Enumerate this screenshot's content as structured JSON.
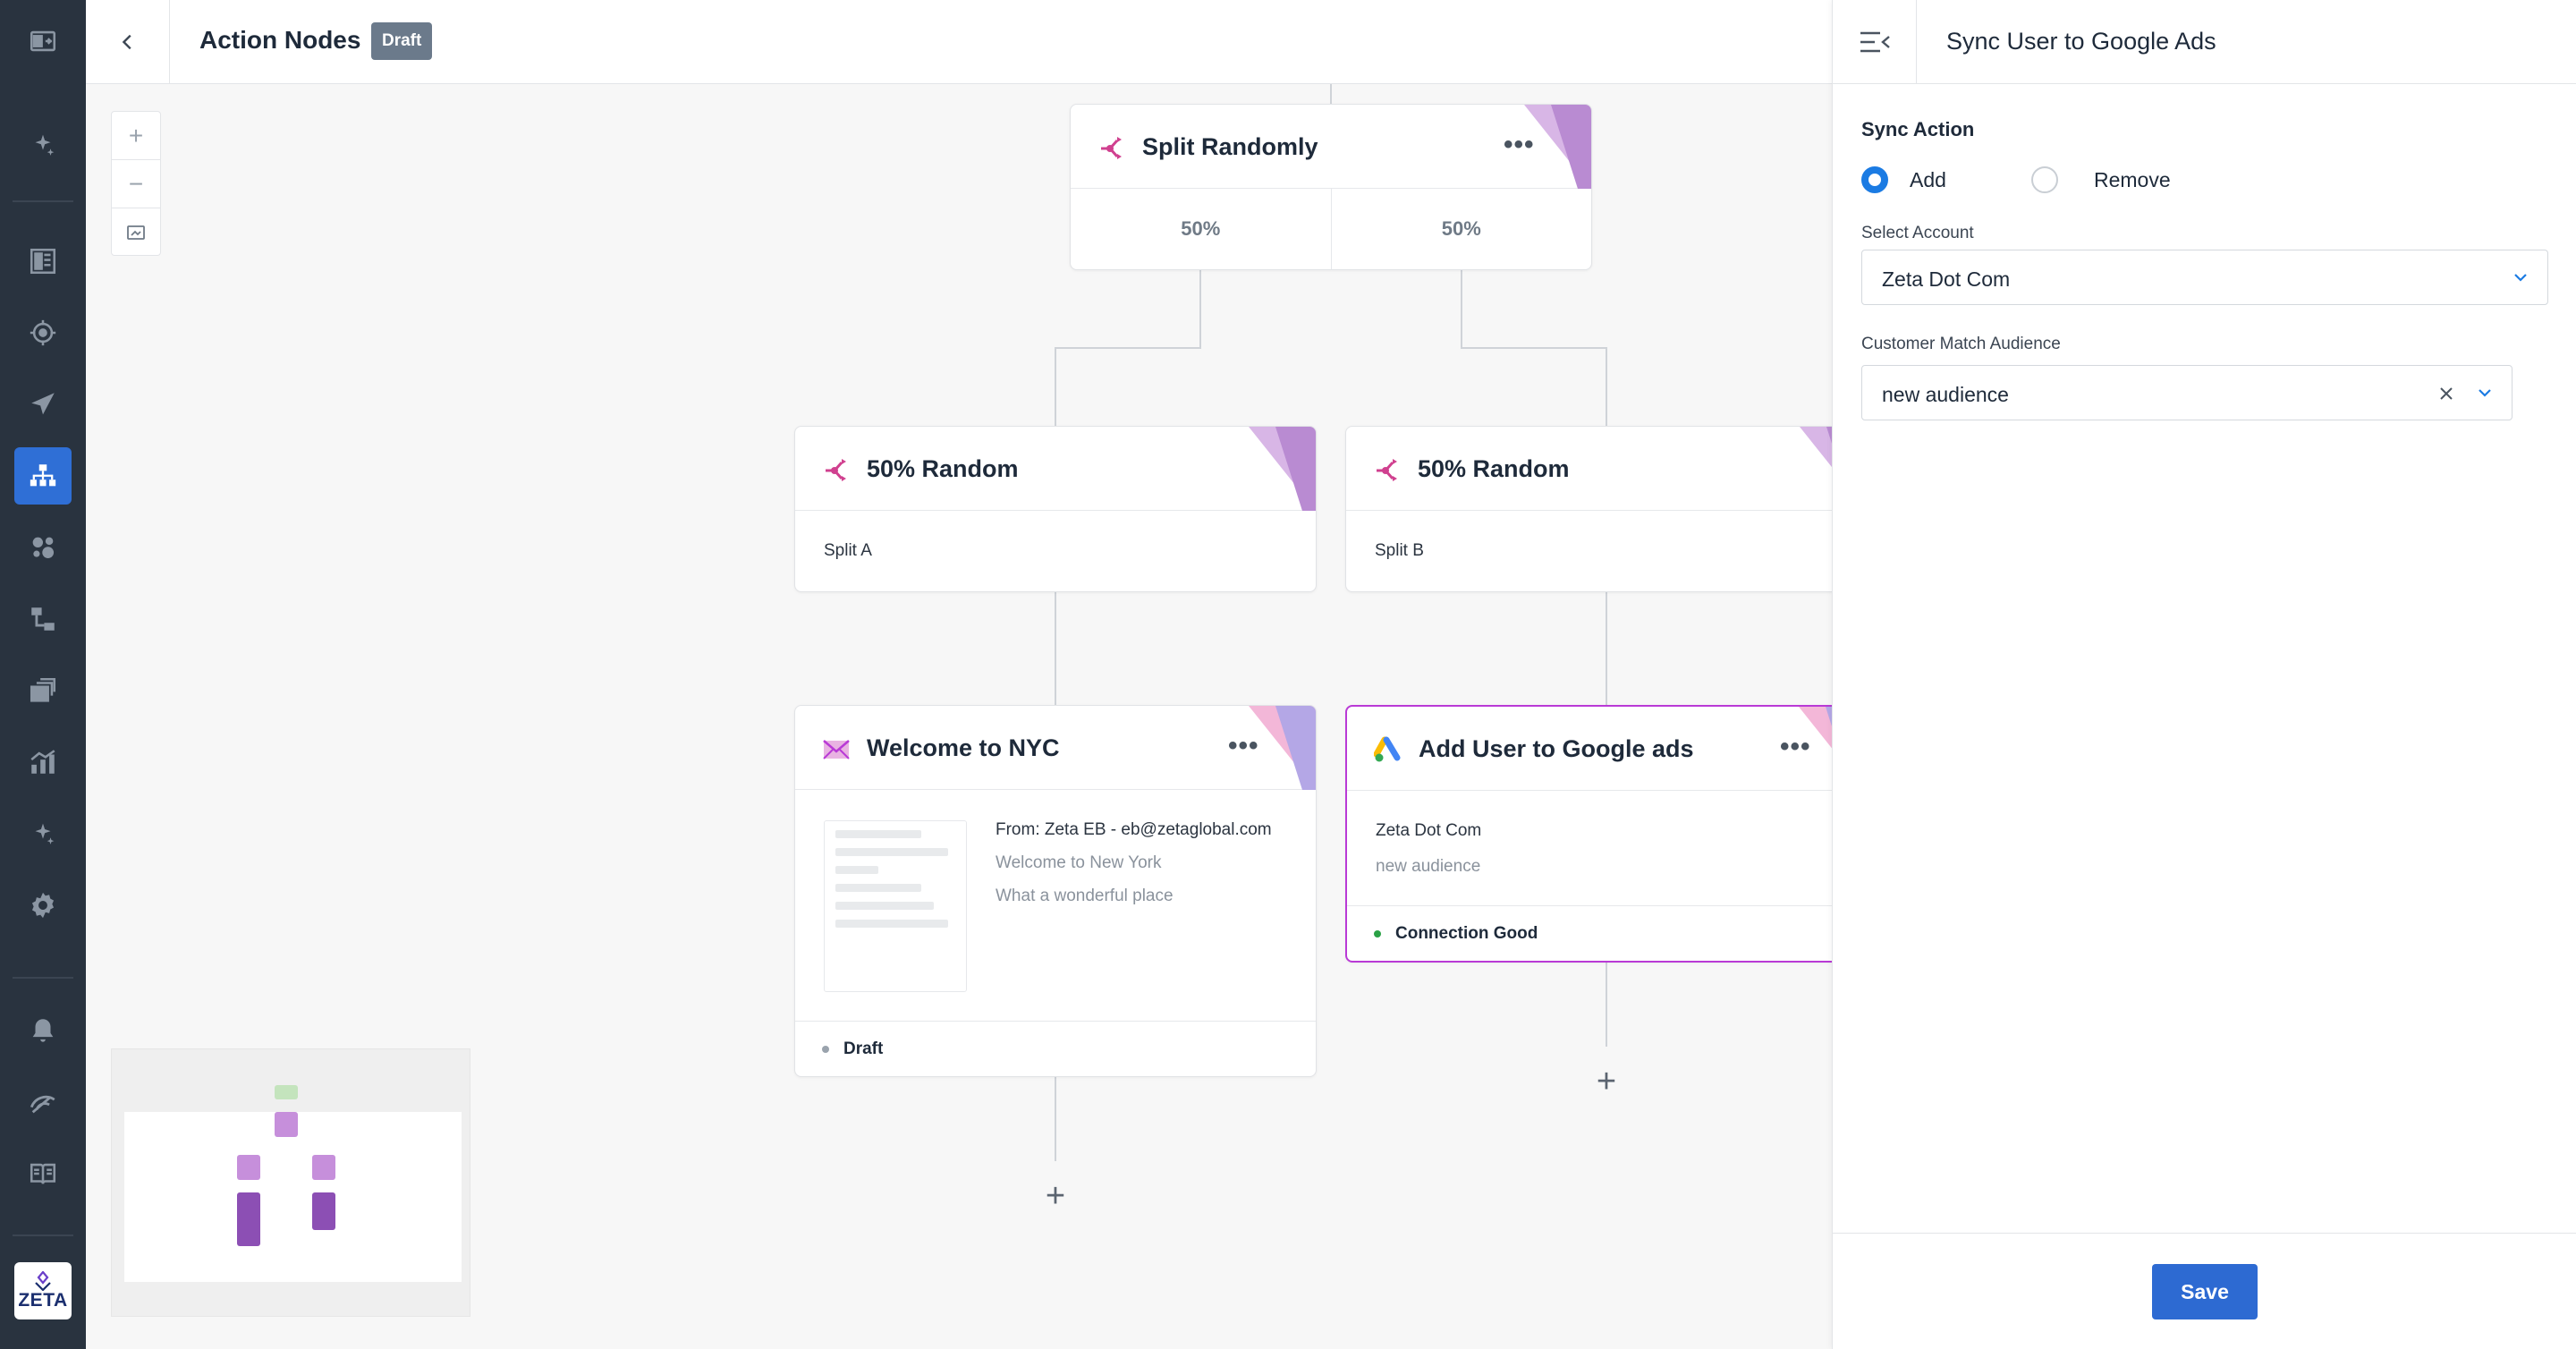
{
  "header": {
    "title": "Action Nodes",
    "status_badge": "Draft"
  },
  "zoom": {
    "in_label": "+",
    "out_label": "−"
  },
  "nodes": {
    "split_randomly": {
      "title": "Split Randomly",
      "more": "•••",
      "left_pct": "50%",
      "right_pct": "50%"
    },
    "random_a": {
      "title": "50% Random",
      "subtitle": "Split A"
    },
    "random_b": {
      "title": "50% Random",
      "subtitle": "Split B"
    },
    "welcome": {
      "title": "Welcome to NYC",
      "more": "•••",
      "from": "From: Zeta EB - eb@zetaglobal.com",
      "subject": "Welcome to New York",
      "preheader": "What a wonderful place",
      "status": "Draft"
    },
    "google_ads": {
      "title": "Add User to Google ads",
      "more": "•••",
      "account": "Zeta Dot Com",
      "audience": "new audience",
      "status": "Connection Good"
    }
  },
  "add_symbol": "+",
  "panel": {
    "title": "Sync User to Google Ads",
    "sync_action_label": "Sync Action",
    "options": [
      {
        "label": "Add",
        "selected": true
      },
      {
        "label": "Remove",
        "selected": false
      }
    ],
    "account_label": "Select Account",
    "account_value": "Zeta Dot Com",
    "audience_label": "Customer Match Audience",
    "audience_value": "new audience",
    "save_label": "Save"
  },
  "sidebar": {
    "items": [
      "exit-icon",
      "sparkle-icon",
      "dashboard-icon",
      "target-icon",
      "send-icon",
      "journey-icon",
      "audience-icon",
      "flow-icon",
      "layers-icon",
      "analytics-icon",
      "ai-icon",
      "settings-icon",
      "bell-icon",
      "signal-icon",
      "docs-icon"
    ],
    "active": "journey-icon",
    "logo_text": "ZETA"
  },
  "colors": {
    "sidebar_bg": "#29333f",
    "active": "#2f6fd6",
    "accent_pink": "#d0408f",
    "selected_border": "#b93ad6",
    "primary": "#2d6ad2",
    "connection_good": "#2aa146"
  }
}
